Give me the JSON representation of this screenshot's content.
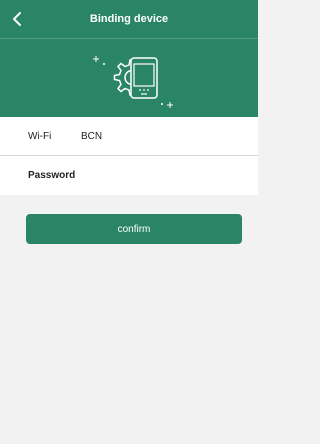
{
  "header": {
    "title": "Binding device",
    "back_icon": "chevron-left-icon",
    "hero_icon": "phone-gear-icon",
    "bg_color": "#2a8566"
  },
  "form": {
    "wifi": {
      "label": "Wi-Fi",
      "value": "BCN"
    },
    "password": {
      "label": "Password",
      "value": ""
    }
  },
  "actions": {
    "confirm_label": "confirm",
    "accent_color": "#2a8566"
  }
}
